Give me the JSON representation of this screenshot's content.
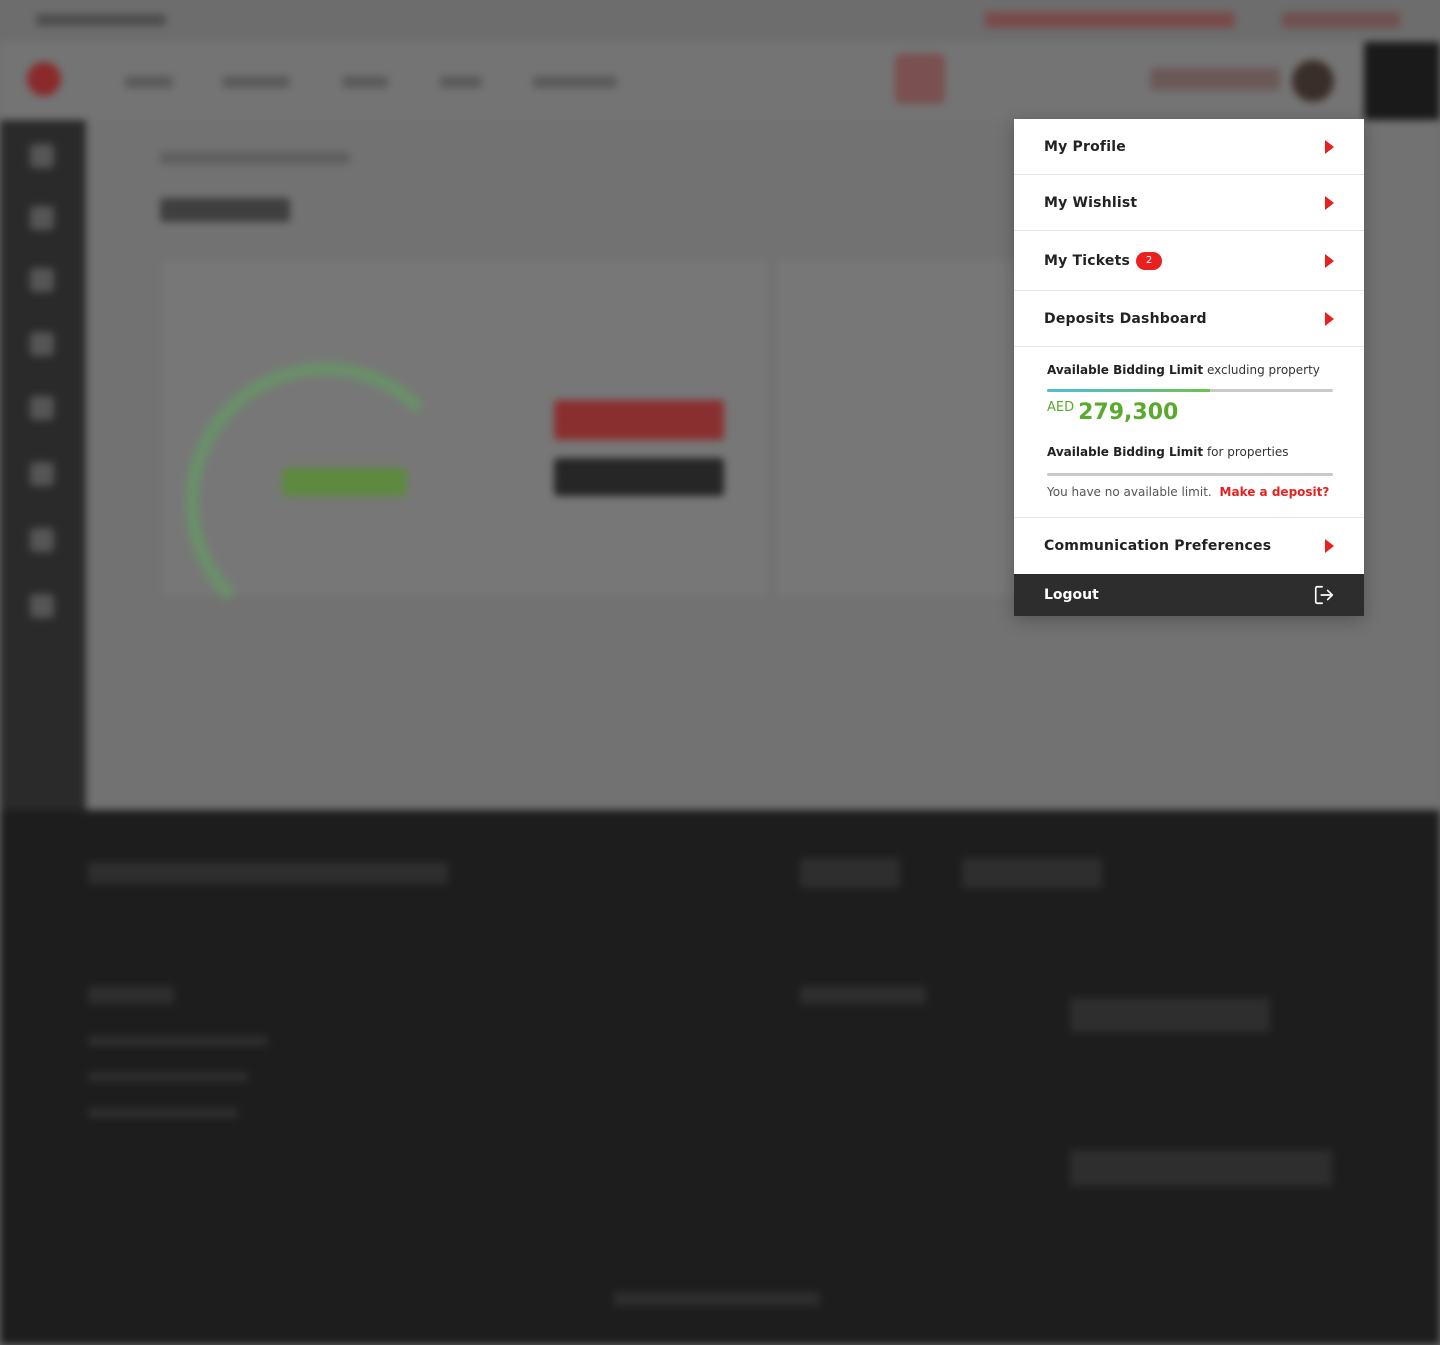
{
  "menu": {
    "items": [
      {
        "label": "My Profile"
      },
      {
        "label": "My Wishlist"
      },
      {
        "label": "My Tickets",
        "badge": "2"
      },
      {
        "label": "Deposits Dashboard"
      }
    ],
    "limits": {
      "bidding_limit_bold": "Available Bidding Limit",
      "bidding_limit_suffix": "excluding property",
      "bidding_limit_progress": 0.57,
      "currency": "AED",
      "amount": "279,300",
      "property_limit_bold": "Available Bidding Limit",
      "property_limit_suffix": "for properties",
      "property_limit_progress": 0,
      "no_limit_text": "You have no available limit.",
      "make_deposit_link": "Make a deposit?"
    },
    "communication_label": "Communication Preferences",
    "logout_label": "Logout"
  },
  "colors": {
    "accent_red": "#e8211f",
    "amount_green": "#5aaa2e",
    "logout_bg": "#2d2d2d"
  }
}
